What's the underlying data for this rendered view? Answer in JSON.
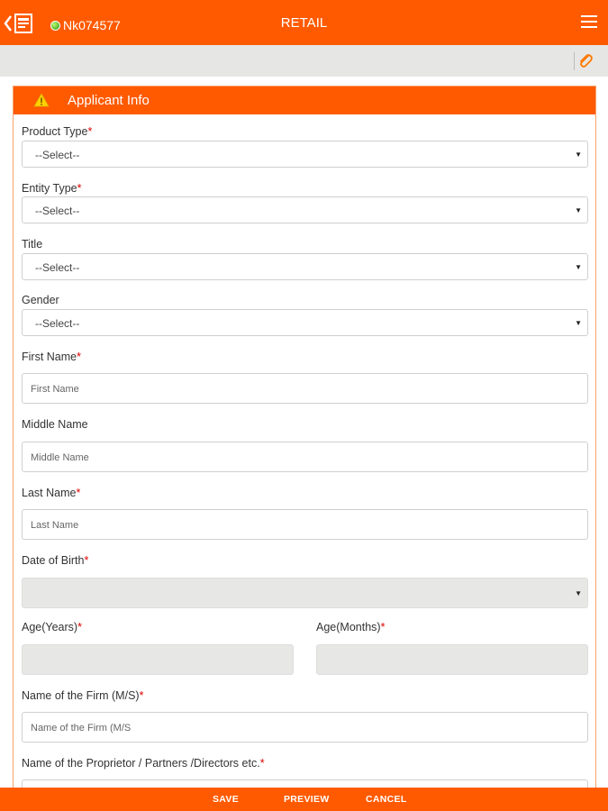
{
  "header": {
    "user_id": "Nk074577",
    "title": "RETAIL",
    "accent_color": "#ff5a00",
    "icons": {
      "back": "back-arrow-document-icon",
      "status": "online-status-dot-icon",
      "menu": "hamburger-menu-icon",
      "attach": "paperclip-icon"
    }
  },
  "section": {
    "title": "Applicant Info",
    "icon": "warning-icon"
  },
  "form": {
    "product_type": {
      "label": "Product Type",
      "required": "*",
      "value": "--Select--"
    },
    "entity_type": {
      "label": "Entity Type",
      "required": "*",
      "value": "--Select--"
    },
    "title": {
      "label": "Title",
      "value": "--Select--"
    },
    "gender": {
      "label": "Gender",
      "value": "--Select--"
    },
    "first_name": {
      "label": "First Name",
      "required": "*",
      "placeholder": "First Name"
    },
    "middle_name": {
      "label": "Middle Name",
      "placeholder": "Middle Name"
    },
    "last_name": {
      "label": "Last Name",
      "required": "*",
      "placeholder": "Last Name"
    },
    "dob": {
      "label": "Date of Birth",
      "required": "*"
    },
    "age_years": {
      "label": "Age(Years)",
      "required": "*"
    },
    "age_months": {
      "label": "Age(Months)",
      "required": "*"
    },
    "firm_name": {
      "label": "Name of the Firm (M/S)",
      "required": "*",
      "placeholder": "Name of the Firm (M/S"
    },
    "proprietor": {
      "label": "Name of the Proprietor / Partners /Directors etc.",
      "required": "*"
    }
  },
  "footer": {
    "save": "SAVE",
    "preview": "PREVIEW",
    "cancel": "CANCEL"
  }
}
